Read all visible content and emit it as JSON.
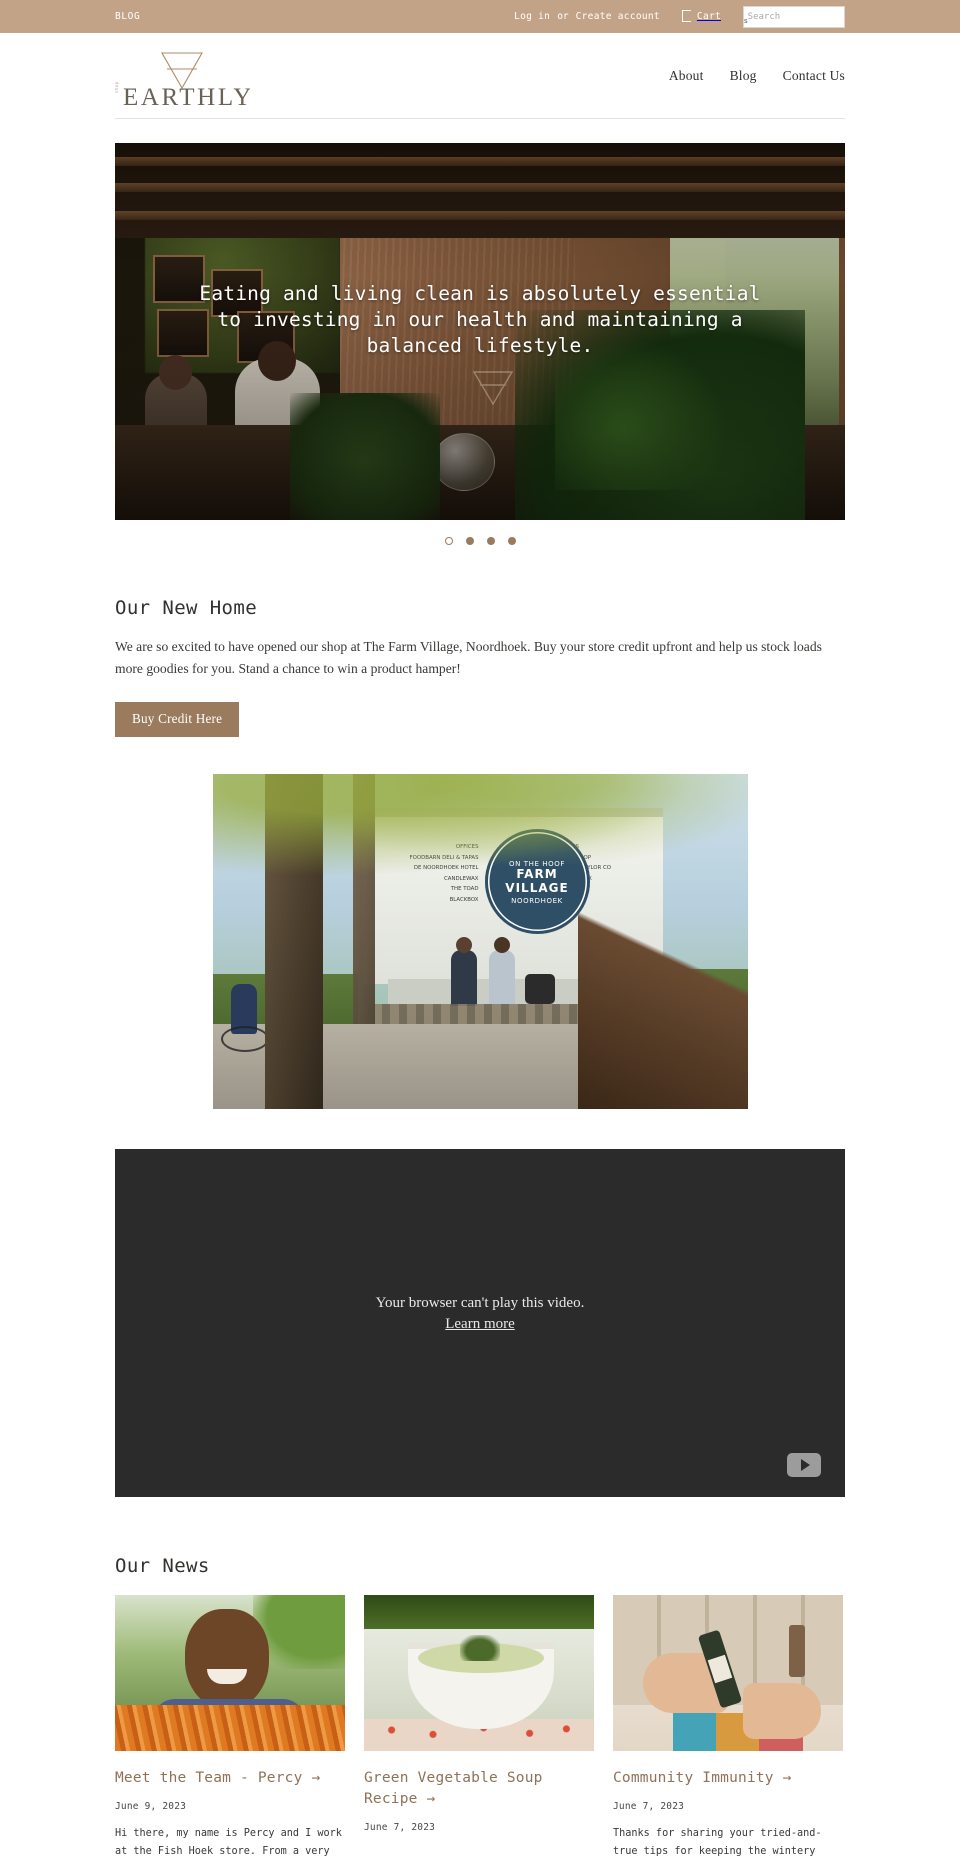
{
  "topbar": {
    "blog_label": "BLOG",
    "login_label": "Log in",
    "or_label": "or",
    "create_account_label": "Create account",
    "cart_label": "Cart",
    "cart_icon": "cart-icon",
    "search_placeholder": "Search",
    "search_value": "",
    "search_submit_glyph": "s",
    "background_color": "#c3a388"
  },
  "header": {
    "logo_wordmark": "EARTHLY",
    "logo_prefix": "shop",
    "logo_icon": "inverted-triangle-icon",
    "nav": [
      {
        "label": "About"
      },
      {
        "label": "Blog"
      },
      {
        "label": "Contact Us"
      }
    ]
  },
  "hero": {
    "caption": "Eating and living clean is absolutely essential to investing in our health and maintaining a balanced lifestyle.",
    "farm_village_text": "FARM VILLAGE",
    "dots": [
      {
        "active": true
      },
      {
        "active": false
      },
      {
        "active": false
      },
      {
        "active": false
      }
    ]
  },
  "new_home": {
    "title": "Our New Home",
    "body": "We are so excited to have opened our shop at The Farm Village, Noordhoek. Buy your store credit upfront and help us stock loads more goodies for you. Stand a chance to win a product hamper!",
    "button_label": "Buy Credit Here",
    "button_color": "#9b7b5e"
  },
  "farm_photo": {
    "sign_title": "FARM",
    "sign_title2": "VILLAGE",
    "sign_top": "ON THE HOOF",
    "sign_bottom": "NOORDHOEK",
    "left_list": "OFFICES\nFOODBARN DELI & TAPAS\nDE NOORDHOEK HOTEL\nCANDLEWAX\nTHE TOAD\nBLACKBOX",
    "right_list": "SHOPS\nTACK SHOP\nKRISTA TAYLOR CO\nCAFE ROUX\nRETREAT"
  },
  "video": {
    "error_message": "Your browser can't play this video.",
    "learn_more_label": "Learn more",
    "play_icon": "play-button-icon",
    "background_color": "#2b2b2b"
  },
  "news": {
    "title": "Our News",
    "cards": [
      {
        "thumb_name": "news-thumb-percy",
        "headline": "Meet the Team - Percy →",
        "date": "June 9, 2023",
        "excerpt": "Hi there, my name is Percy and I work at the Fish Hoek store. From a very"
      },
      {
        "thumb_name": "news-thumb-soup",
        "headline": "Green Vegetable Soup Recipe →",
        "date": "June 7, 2023",
        "excerpt": ""
      },
      {
        "thumb_name": "news-thumb-immunity",
        "headline": "Community Immunity →",
        "date": "June 7, 2023",
        "excerpt": "Thanks for sharing your tried-and-true tips for keeping the wintery"
      }
    ]
  }
}
